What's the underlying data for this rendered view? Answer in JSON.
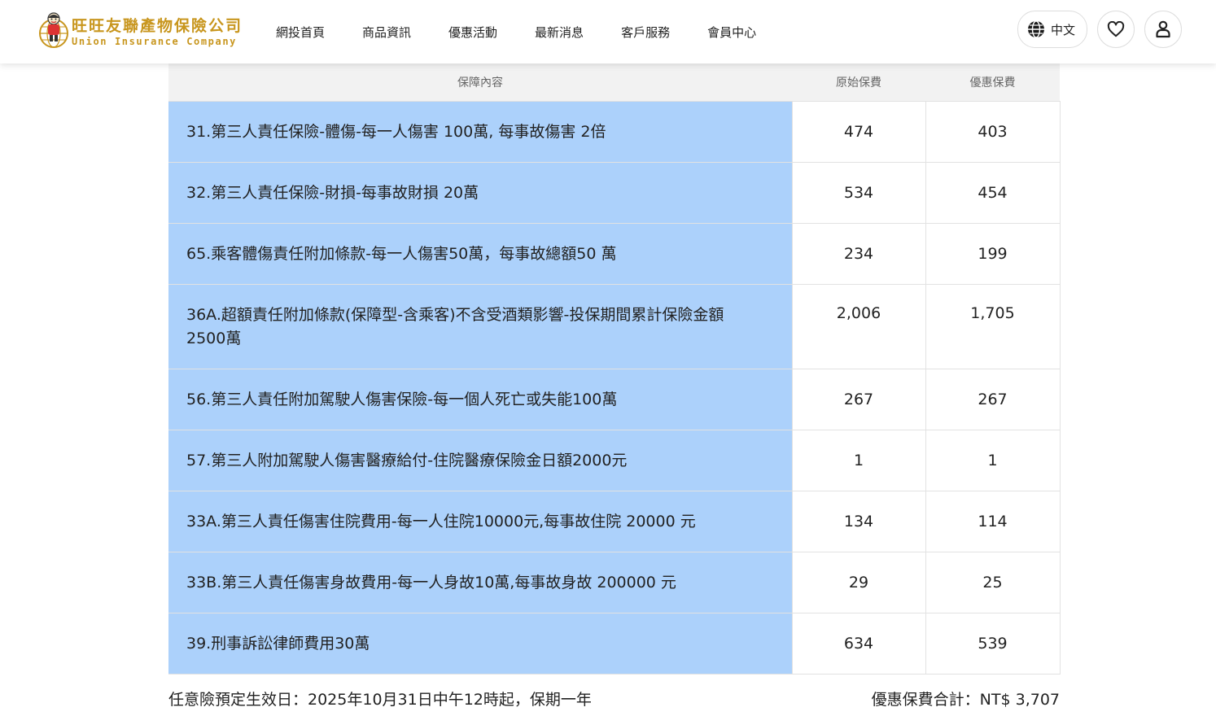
{
  "header": {
    "logo_cn": "旺旺友聯產物保險公司",
    "logo_en": "Union Insurance Company",
    "nav": [
      "網投首頁",
      "商品資訊",
      "優惠活動",
      "最新消息",
      "客戶服務",
      "會員中心"
    ],
    "lang_label": "中文"
  },
  "table": {
    "headers": [
      "保障內容",
      "原始保費",
      "優惠保費"
    ],
    "rows": [
      {
        "item": "31.第三人責任保險-體傷-每一人傷害 100萬, 每事故傷害 2倍",
        "original": "474",
        "discount": "403"
      },
      {
        "item": "32.第三人責任保險-財損-每事故財損 20萬",
        "original": "534",
        "discount": "454"
      },
      {
        "item": "65.乘客體傷責任附加條款-每一人傷害50萬，每事故總額50 萬",
        "original": "234",
        "discount": "199"
      },
      {
        "item": "36A.超額責任附加條款(保障型-含乘客)不含受酒類影響-投保期間累計保險金額2500萬",
        "original": "2,006",
        "discount": "1,705"
      },
      {
        "item": "56.第三人責任附加駕駛人傷害保險-每一個人死亡或失能100萬",
        "original": "267",
        "discount": "267"
      },
      {
        "item": "57.第三人附加駕駛人傷害醫療給付-住院醫療保險金日額2000元",
        "original": "1",
        "discount": "1"
      },
      {
        "item": "33A.第三人責任傷害住院費用-每一人住院10000元,每事故住院 20000 元",
        "original": "134",
        "discount": "114"
      },
      {
        "item": "33B.第三人責任傷害身故費用-每一人身故10萬,每事故身故 200000 元",
        "original": "29",
        "discount": "25"
      },
      {
        "item": "39.刑事訴訟律師費用30萬",
        "original": "634",
        "discount": "539"
      }
    ]
  },
  "footer": {
    "effective_date": "任意險預定生效日：2025年10月31日中午12時起，保期一年",
    "total": "優惠保費合計：NT$ 3,707"
  },
  "colors": {
    "item_bg": "#acd1fb",
    "header_bg": "#f2f2f2",
    "logo_gold": "#c8961e"
  }
}
